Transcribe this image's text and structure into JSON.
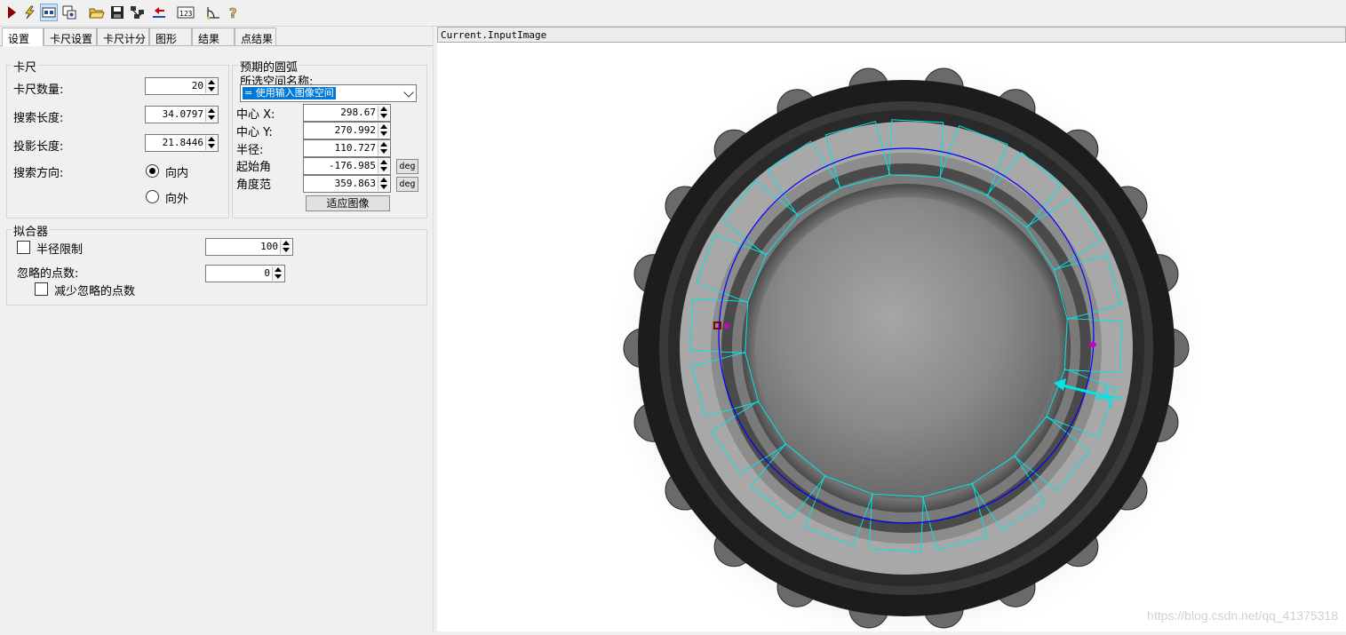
{
  "toolbar": {
    "icons": [
      "run-icon",
      "electric-icon",
      "show-image-icon",
      "settings-icon",
      "open-folder-icon",
      "save-icon",
      "network-icon",
      "reset-icon",
      "numeric-icon",
      "measure-icon",
      "help-icon"
    ]
  },
  "tabs": [
    "设置",
    "卡尺设置",
    "卡尺计分",
    "图形",
    "结果",
    "点结果"
  ],
  "caliper": {
    "title": "卡尺",
    "count_label": "卡尺数量:",
    "count_value": "20",
    "search_len_label": "搜索长度:",
    "search_len_value": "34.0797",
    "proj_len_label": "投影长度:",
    "proj_len_value": "21.8446",
    "direction_label": "搜索方向:",
    "inward_label": "向内",
    "outward_label": "向外",
    "direction_selected": "向内"
  },
  "arc": {
    "title": "预期的圆弧",
    "space_label": "所选空间名称:",
    "space_value": " = 使用输入图像空间",
    "cx_label": "中心 X:",
    "cx_value": "298.67",
    "cy_label": "中心 Y:",
    "cy_value": "270.992",
    "radius_label": "半径:",
    "radius_value": "110.727",
    "start_label": "起始角",
    "start_value": "-176.985",
    "span_label": "角度范",
    "span_value": "359.863",
    "deg_label": "deg",
    "fit_button": "适应图像"
  },
  "fitter": {
    "title": "拟合器",
    "radius_limit_label": "半径限制",
    "radius_limit_checked": false,
    "radius_limit_value": "100",
    "ignore_label": "忽略的点数:",
    "ignore_value": "0",
    "reduce_label": "减少忽略的点数",
    "reduce_checked": false
  },
  "image": {
    "header": "Current.InputImage",
    "watermark": "https://blog.csdn.net/qq_41375318",
    "colors": {
      "caliper": "#00e6e6",
      "circle": "#0000ff",
      "marker": "#cc00cc"
    }
  }
}
